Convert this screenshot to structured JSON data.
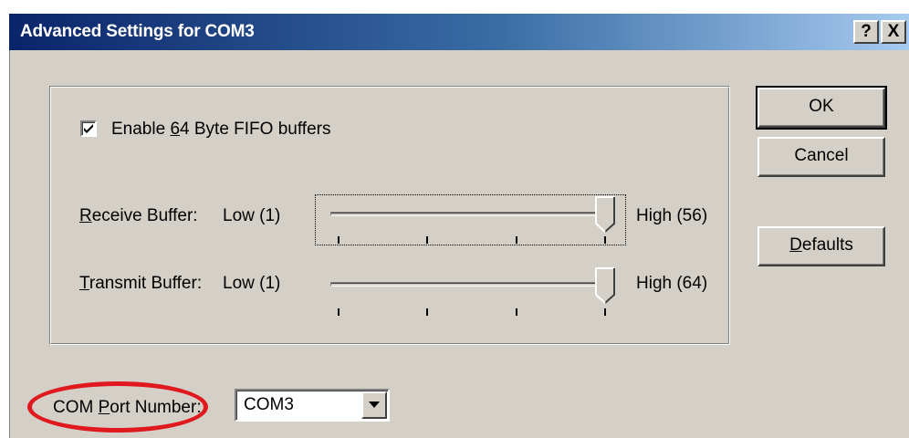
{
  "window": {
    "title": "Advanced Settings for COM3",
    "help_glyph": "?",
    "close_glyph": "X"
  },
  "fifo": {
    "checked": true,
    "label_before": "Enable ",
    "label_mnemonic": "6",
    "label_after": "4 Byte FIFO buffers"
  },
  "receive": {
    "label_mnemonic": "R",
    "label_rest": "eceive Buffer:",
    "low_label": "Low (1)",
    "high_label": "High (56)",
    "level_fraction": 1.0
  },
  "transmit": {
    "label_mnemonic": "T",
    "label_rest": "ransmit Buffer:",
    "low_label": "Low (1)",
    "high_label": "High (64)",
    "level_fraction": 1.0
  },
  "buttons": {
    "ok": "OK",
    "cancel": "Cancel",
    "defaults_mnemonic": "D",
    "defaults_rest": "efaults"
  },
  "com_port": {
    "label_before": "COM ",
    "label_mnemonic": "P",
    "label_after": "ort Number:",
    "value": "COM3"
  },
  "colors": {
    "face": "#d4d0c8",
    "title_start": "#0a246a",
    "title_end": "#a6caf0",
    "highlight": "#e0191e"
  }
}
